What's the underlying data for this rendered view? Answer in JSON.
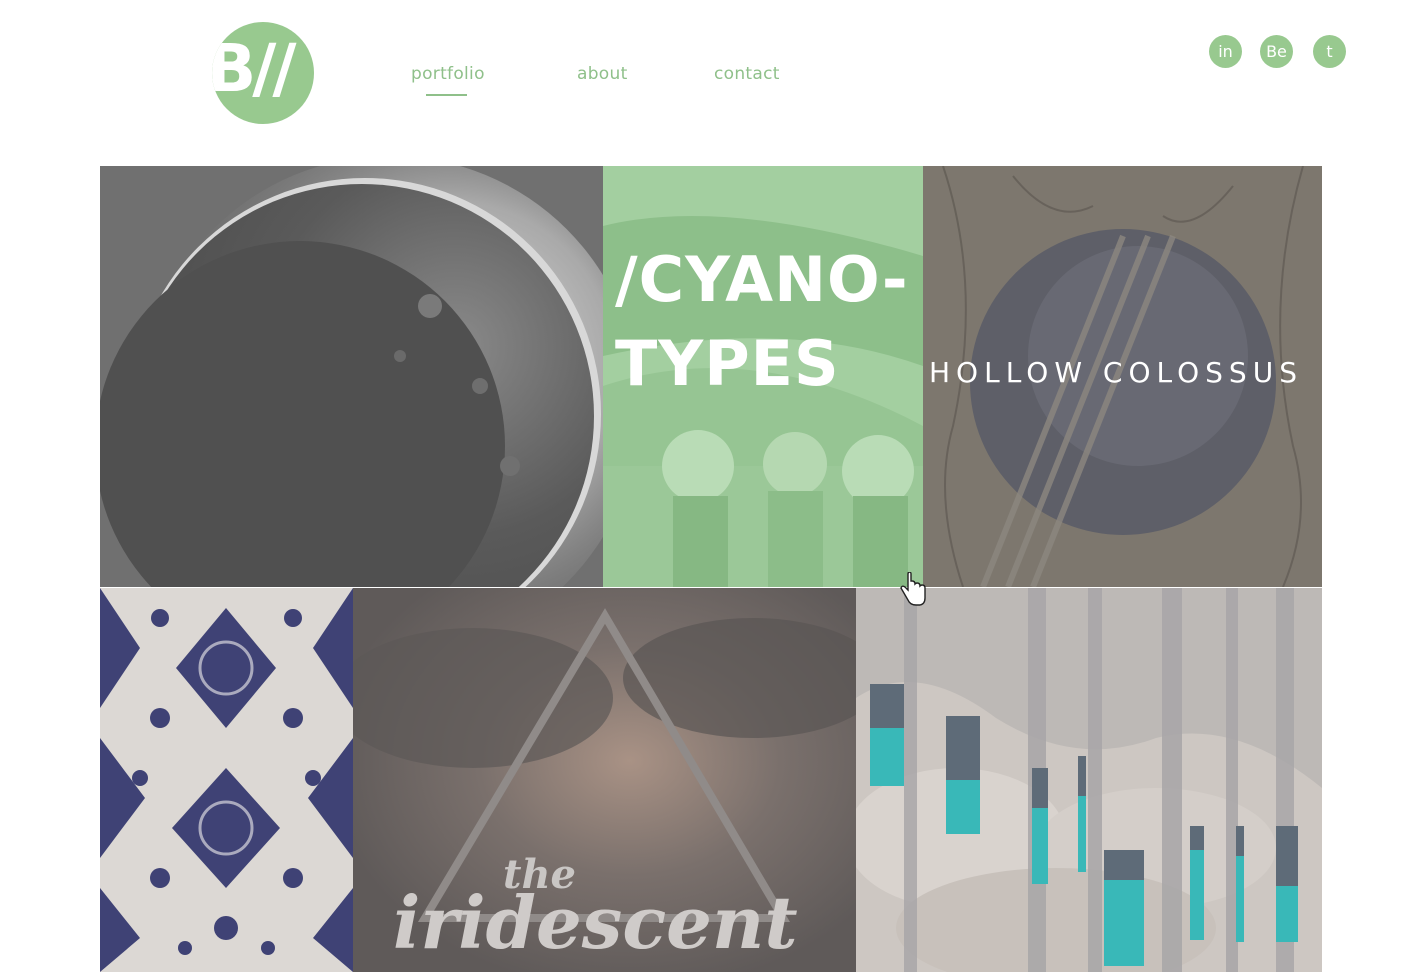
{
  "logo": {
    "text": "B//"
  },
  "nav": {
    "items": [
      {
        "label": "portfolio",
        "active": true
      },
      {
        "label": "about",
        "active": false
      },
      {
        "label": "contact",
        "active": false
      }
    ]
  },
  "social": [
    {
      "label": "in",
      "icon": "linkedin-icon"
    },
    {
      "label": "Be",
      "icon": "behance-icon"
    },
    {
      "label": "t",
      "icon": "twitter-icon"
    }
  ],
  "portfolio": {
    "tiles": [
      {
        "name": "moon",
        "label": ""
      },
      {
        "name": "cyanotypes",
        "label": "/CYANO-\nTYPES"
      },
      {
        "name": "hollow-colossus",
        "label": "HOLLOW COLOSSUS"
      },
      {
        "name": "pattern",
        "label": ""
      },
      {
        "name": "the-iridescent",
        "label": "the iridescent"
      },
      {
        "name": "rocks",
        "label": ""
      }
    ]
  },
  "colors": {
    "accent": "#98c98f",
    "nav_text": "#8fc08a",
    "background": "#ffffff"
  }
}
